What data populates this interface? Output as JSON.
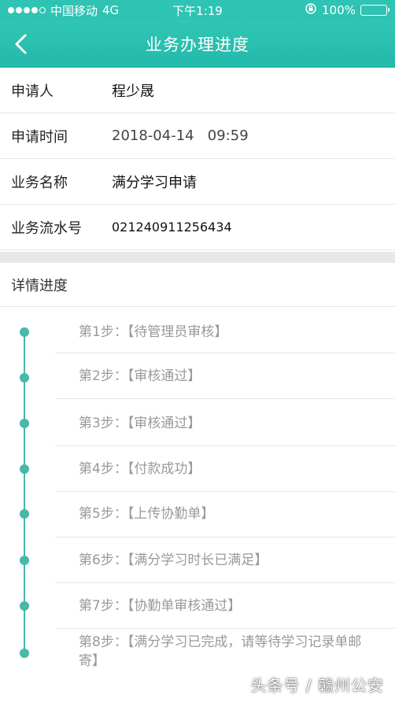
{
  "status_bar": {
    "carrier": "中国移动",
    "network": "4G",
    "time": "下午1:19",
    "battery": "100%"
  },
  "nav": {
    "title": "业务办理进度",
    "back_icon": "chevron-left-icon"
  },
  "info": [
    {
      "label": "申请人",
      "value": "程少晟"
    },
    {
      "label": "申请时间",
      "value": "2018-04-14   09:59"
    },
    {
      "label": "业务名称",
      "value": "满分学习申请"
    },
    {
      "label": "业务流水号",
      "value": "021240911256434"
    }
  ],
  "detail": {
    "heading": "详情进度",
    "steps": [
      {
        "text": "第1步：【待管理员审核】"
      },
      {
        "text": "第2步：【审核通过】"
      },
      {
        "text": "第3步：【审核通过】"
      },
      {
        "text": "第4步：【付款成功】"
      },
      {
        "text": "第5步：【上传协勤单】"
      },
      {
        "text": "第6步：【满分学习时长已满足】"
      },
      {
        "text": "第7步：【协勤单审核通过】"
      },
      {
        "text": "第8步：【满分学习已完成，请等待学习记录单邮寄】"
      }
    ]
  },
  "watermark": "头条号 / 赣州公安",
  "colors": {
    "accent": "#2fc3b3",
    "timeline": "#48b8a8",
    "divider": "#e6e6e6"
  }
}
